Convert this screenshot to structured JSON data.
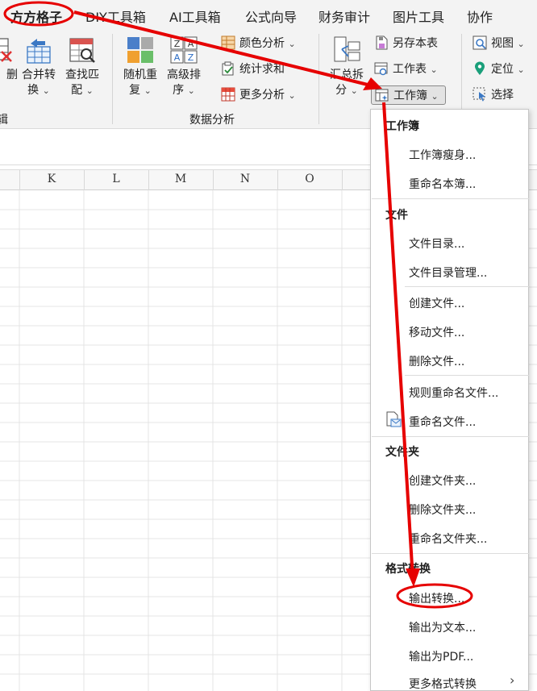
{
  "menubar": {
    "tabs": [
      "方方格子",
      "DIY工具箱",
      "AI工具箱",
      "公式向导",
      "财务审计",
      "图片工具",
      "协作"
    ]
  },
  "ribbon": {
    "left_partial": {
      "delete_label_1": "删",
      "delete_label_2": "",
      "group_label_partial": "辑"
    },
    "merge_convert": {
      "line1": "合并转",
      "line2": "换"
    },
    "lookup_match": {
      "line1": "查找匹",
      "line2": "配"
    },
    "random_repeat": {
      "line1": "随机重",
      "line2": "复"
    },
    "advanced_sort": {
      "line1": "高级排",
      "line2": "序"
    },
    "color_analysis": "颜色分析",
    "stat_sum": "统计求和",
    "more_analysis": "更多分析",
    "data_analysis_group": "数据分析",
    "summary_split": {
      "line1": "汇总拆",
      "line2": "分"
    },
    "save_as_sheet": "另存本表",
    "worksheet": "工作表",
    "workbook": "工作簿",
    "view": "视图",
    "locate": "定位",
    "select": "选择"
  },
  "grid": {
    "columns": [
      "K",
      "L",
      "M",
      "N",
      "O"
    ]
  },
  "dropdown": {
    "sections": [
      {
        "title": "工作簿",
        "items": [
          "工作簿瘦身...",
          "重命名本簿..."
        ]
      },
      {
        "title": "文件",
        "items": [
          "文件目录...",
          "文件目录管理...",
          "创建文件...",
          "移动文件...",
          "删除文件...",
          "规则重命名文件...",
          "重命名文件..."
        ]
      },
      {
        "title": "文件夹",
        "items": [
          "创建文件夹...",
          "删除文件夹...",
          "重命名文件夹..."
        ]
      },
      {
        "title": "格式转换",
        "items": [
          "输出转换...",
          "输出为文本...",
          "输出为PDF...",
          "更多格式转换"
        ]
      }
    ]
  },
  "colors": {
    "annotation_red": "#e60000",
    "ribbon_bg": "#f3f3f3",
    "grid_line": "#e4e4e4"
  }
}
